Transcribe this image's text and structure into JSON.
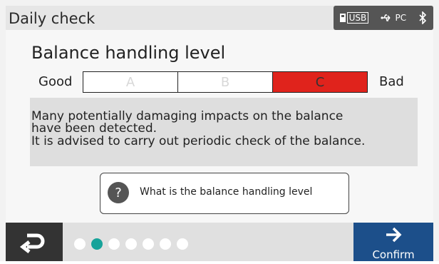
{
  "header": {
    "title": "Daily check",
    "status": {
      "usb_label": "USB",
      "pc_label": "PC",
      "usb_icon": "usb-icon",
      "pc_icon": "usb-cable-icon",
      "bluetooth_icon": "bluetooth-icon"
    }
  },
  "main": {
    "heading": "Balance handling level",
    "scale": {
      "good_label": "Good",
      "bad_label": "Bad",
      "levels": [
        "A",
        "B",
        "C"
      ],
      "selected": "C",
      "selected_color": "#e0231c"
    },
    "message": {
      "line1": "Many potentially damaging impacts on the balance",
      "line2": "have been detected.",
      "line3": "It is advised to carry out periodic check of the balance."
    },
    "help": {
      "icon_label": "?",
      "text": "What is the balance handling level"
    }
  },
  "footer": {
    "back_icon": "return-arrow-icon",
    "pagination": {
      "total": 7,
      "current": 2,
      "active_color": "#17a39a"
    },
    "confirm_label": "Confirm",
    "confirm_icon": "arrow-right-icon"
  }
}
